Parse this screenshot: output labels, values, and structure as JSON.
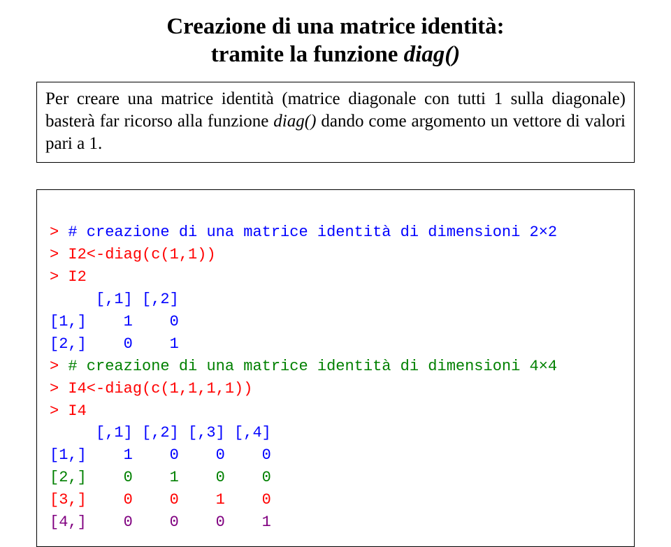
{
  "title": {
    "line1": "Creazione di una matrice identità:",
    "line2_plain": "tramite la  funzione ",
    "line2_italic": "diag()"
  },
  "explain": {
    "part1": "Per creare una matrice identità (matrice diagonale con tutti 1 sulla diagonale) basterà far ricorso alla funzione ",
    "italic": "diag()",
    "part2": " dando come argomento un vettore di valori pari a 1."
  },
  "code": {
    "l01": {
      "prompt": "> ",
      "comment": "# creazione di una matrice identità di dimensioni 2×2"
    },
    "l02": {
      "prompt": "> ",
      "text": "I2<-diag(c(1,1))"
    },
    "l03": {
      "prompt": "> ",
      "text": "I2"
    },
    "l04": "     [,1] [,2]",
    "l05": "[1,]    1    0",
    "l06": "[2,]    0    1",
    "l07": {
      "prompt": "> ",
      "comment": "# creazione di una matrice identità di dimensioni 4×4"
    },
    "l08": {
      "prompt": "> ",
      "text": "I4<-diag(c(1,1,1,1))"
    },
    "l09": {
      "prompt": "> ",
      "text": "I4"
    },
    "l10": "     [,1] [,2] [,3] [,4]",
    "l11": "[1,]    1    0    0    0",
    "l12": "[2,]    0    1    0    0",
    "l13": "[3,]    0    0    1    0",
    "l14": "[4,]    0    0    0    1"
  }
}
